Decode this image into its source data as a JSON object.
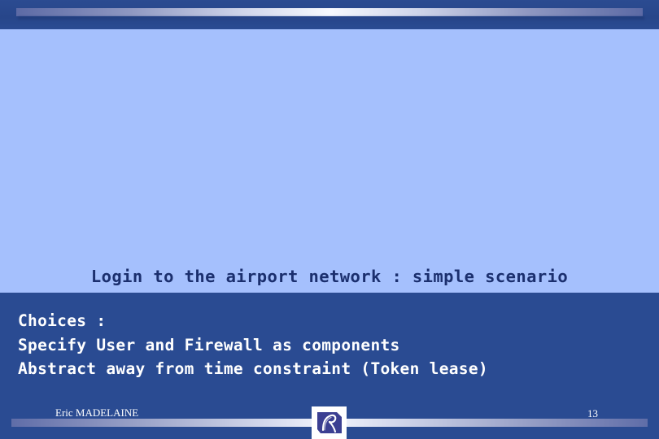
{
  "slide": {
    "title": "Login to the airport network : simple scenario",
    "body_lines": [
      "Choices :",
      "Specify User and Firewall as components",
      "Abstract away from time constraint (Token lease)"
    ]
  },
  "footer": {
    "author": "Eric MADELAINE",
    "page_number": "13",
    "logo_icon": "inria-logo-icon"
  },
  "colors": {
    "background_light": "#a5c0fd",
    "panel_dark": "#2a4b92",
    "title_text": "#1b2f6e",
    "body_text": "#ffffff",
    "stripe_highlight": "#f7f9fe"
  }
}
